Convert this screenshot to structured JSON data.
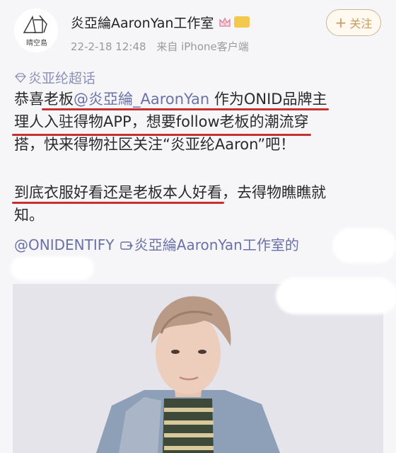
{
  "header": {
    "avatar_caption": "晴空島",
    "author_name": "炎亞綸AaronYan工作室",
    "timestamp": "22-2-18 12:48",
    "source": "来自 iPhone客户端",
    "follow_label": "关注"
  },
  "post": {
    "topic": "炎亚纶超话",
    "p1_l1_a": "恭喜",
    "p1_l1_b": "老板",
    "p1_l1_c": "@炎亞綸_AaronYan",
    "p1_l1_d": " 作为ONID品牌主",
    "p1_l2": "理人入驻得物APP，想要follow老板的潮流穿",
    "p1_l3": "搭，快来得物社区关注“炎亚纶Aaron”吧！",
    "p2_l1_a": "到底衣服好看还是老板本人好看",
    "p2_l1_b": "，去得物瞧瞧就",
    "p2_l2": "知。",
    "tag_mention": "@ONIDENTIFY",
    "tag_source": "炎亞綸AaronYan工作室的"
  },
  "colors": {
    "mention": "#6a71a8",
    "underline": "#c7302f",
    "follow": "#c79a5e"
  }
}
